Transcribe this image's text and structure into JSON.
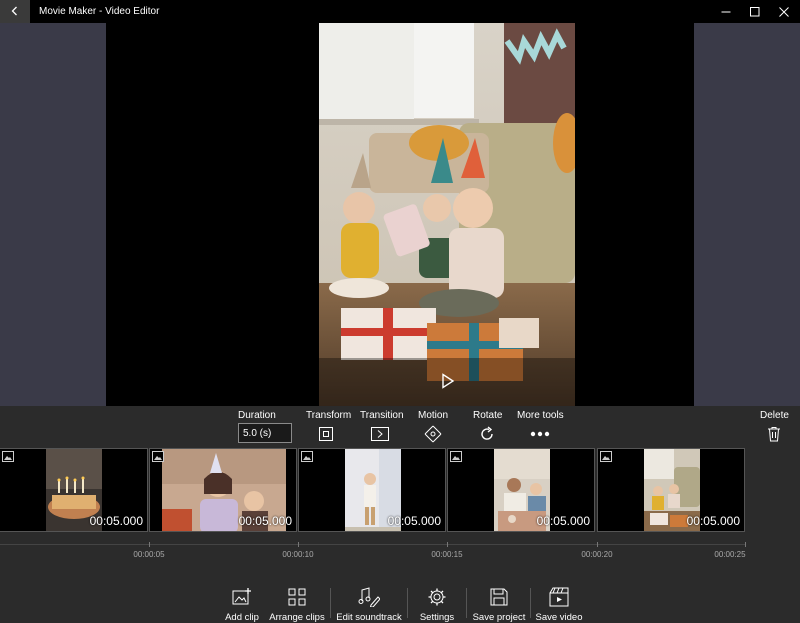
{
  "window": {
    "title": "Movie Maker - Video Editor",
    "back_icon": "back-arrow-icon",
    "controls": [
      "minimize-icon",
      "maximize-icon",
      "close-icon"
    ]
  },
  "toolbar": {
    "duration_label": "Duration",
    "duration_value": "5.0 (s)",
    "transform_label": "Transform",
    "transition_label": "Transition",
    "motion_label": "Motion",
    "rotate_label": "Rotate",
    "more_tools_label": "More tools",
    "delete_label": "Delete"
  },
  "clips": [
    {
      "duration": "00:05.000",
      "icon": "image-icon"
    },
    {
      "duration": "00:05.000",
      "icon": "image-icon"
    },
    {
      "duration": "00:05.000",
      "icon": "image-icon"
    },
    {
      "duration": "00:05.000",
      "icon": "image-icon"
    },
    {
      "duration": "00:05.000",
      "icon": "image-icon"
    }
  ],
  "timeline": {
    "marks": [
      "00:00:05",
      "00:00:10",
      "00:00:15",
      "00:00:20",
      "00:00:25"
    ]
  },
  "bottom_bar": {
    "add_clip": "Add clip",
    "arrange_clips": "Arrange clips",
    "edit_soundtrack": "Edit soundtrack",
    "settings": "Settings",
    "save_project": "Save project",
    "save_video": "Save video"
  },
  "colors": {
    "background": "#2b2b2b",
    "titlebar": "#000000",
    "preview_side": "#3a3a48"
  }
}
